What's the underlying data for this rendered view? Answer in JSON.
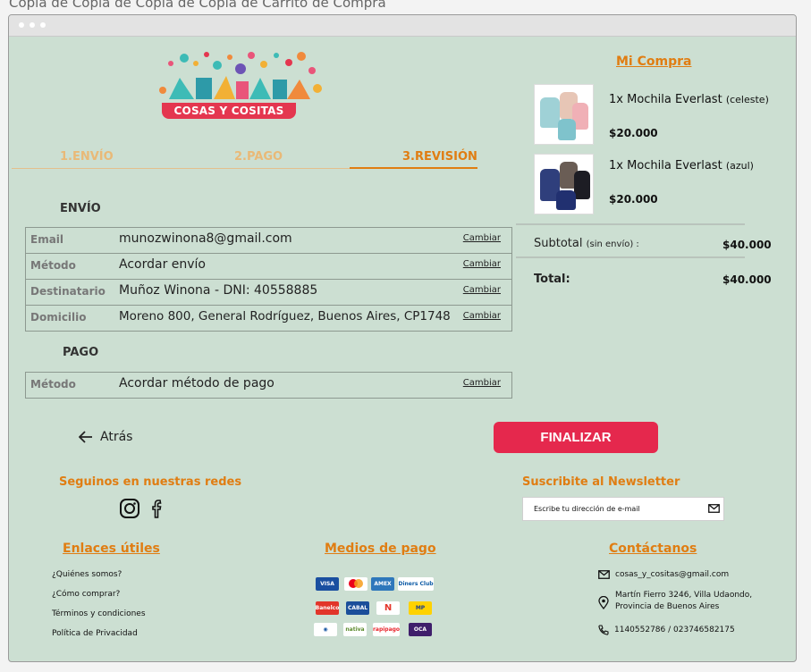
{
  "page_title": "Copia de Copia de Copia de Copia de Carrito de Compra",
  "logo": {
    "text": "COSAS Y COSITAS"
  },
  "steps": [
    {
      "label": "1.ENVÍO"
    },
    {
      "label": "2.PAGO"
    },
    {
      "label": "3.REVISIÓN"
    }
  ],
  "shipping": {
    "heading": "ENVÍO",
    "rows": [
      {
        "label": "Email",
        "value": "munozwinona8@gmail.com",
        "action": "Cambiar"
      },
      {
        "label": "Método",
        "value": "Acordar envío",
        "action": "Cambiar"
      },
      {
        "label": "Destinatario",
        "value": "Muñoz Winona - DNI: 40558885",
        "action": "Cambiar"
      },
      {
        "label": "Domicilio",
        "value": "Moreno 800, General Rodríguez, Buenos Aires, CP1748",
        "action": "Cambiar"
      }
    ]
  },
  "payment": {
    "heading": "PAGO",
    "rows": [
      {
        "label": "Método",
        "value": "Acordar método de pago",
        "action": "Cambiar"
      }
    ]
  },
  "cart": {
    "title": "Mi Compra",
    "items": [
      {
        "name": "1x Mochila Everlast",
        "variant": "(celeste)",
        "price": "$20.000"
      },
      {
        "name": "1x Mochila Everlast",
        "variant": "(azul)",
        "price": "$20.000"
      }
    ],
    "subtotal_label": "Subtotal",
    "subtotal_note": "(sin envío) :",
    "subtotal_value": "$40.000",
    "total_label": "Total:",
    "total_value": "$40.000"
  },
  "nav": {
    "back_label": "Atrás",
    "finish_label": "FINALIZAR"
  },
  "footer": {
    "social_title": "Seguinos en nuestras redes",
    "newsletter_title": "Suscribite al Newsletter",
    "newsletter_placeholder": "Escribe tu dirección de e-mail",
    "links_title": "Enlaces útiles",
    "links": [
      "¿Quiénes somos?",
      "¿Cómo comprar?",
      "Términos y condiciones",
      "Política de Privacidad"
    ],
    "payments_title": "Medios de pago",
    "payment_methods": [
      "VISA",
      "mastercard",
      "AMEX",
      "Diners Club",
      "Banelco",
      "CABAL",
      "Naranja",
      "Mercado Pago",
      "Banco",
      "nativa",
      "rapipago",
      "OCA"
    ],
    "contact_title": "Contáctanos",
    "contact_email": "cosas_y_cositas@gmail.com",
    "contact_address_1": "Martín Fierro 3246, Villa Udaondo,",
    "contact_address_2": "Provincia de Buenos Aires",
    "contact_phone": "1140552786 / 023746582175"
  },
  "colors": {
    "background": "#ccdfd2",
    "accent": "#e07d12",
    "primary_button": "#e5284d"
  }
}
